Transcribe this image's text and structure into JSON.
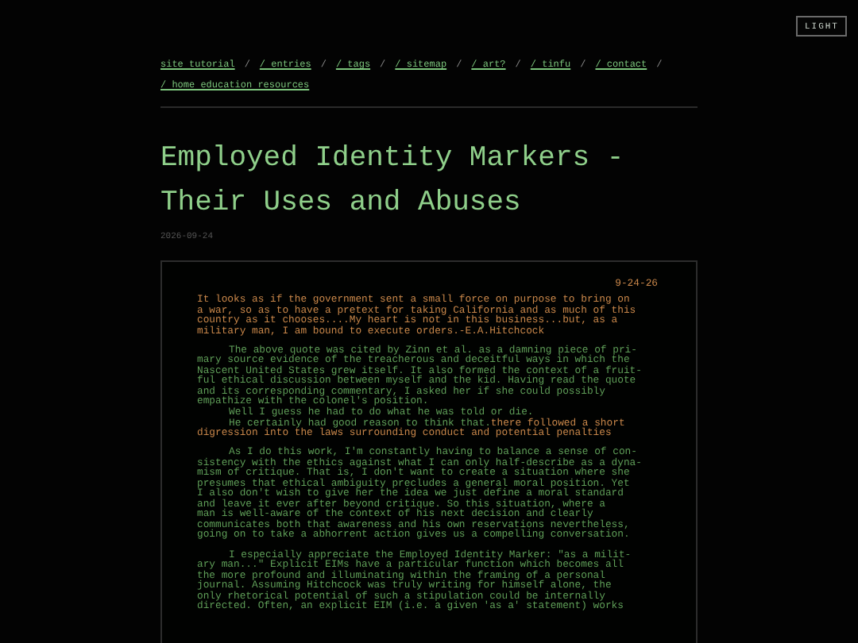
{
  "theme_button": "LIGHT",
  "nav": {
    "links": [
      "site tutorial",
      "/ entries",
      "/ tags",
      "/ sitemap",
      "/ art?",
      "/ tinfu",
      "/ contact",
      "/ home education resources"
    ],
    "separator": "/"
  },
  "title": "Employed Identity Markers - Their Uses and Abuses",
  "date": "2026-09-24",
  "document": {
    "date": "9-24-26",
    "paragraphs": [
      {
        "lines": [
          {
            "indent": false,
            "segments": [
              {
                "text": "It looks as if the government sent a small force on purpose to bring on",
                "color": "#c9874a"
              }
            ]
          },
          {
            "indent": false,
            "segments": [
              {
                "text": "a war, so as to have a pretext for taking California and as much of this",
                "color": "#c9874a"
              }
            ]
          },
          {
            "indent": false,
            "segments": [
              {
                "text": "country as it chooses....My heart is not in this business...but, as a",
                "color": "#c9874a"
              }
            ]
          },
          {
            "indent": false,
            "segments": [
              {
                "text": "military man, I am bound to execute orders.-E.A.Hitchcock",
                "color": "#c9874a"
              }
            ]
          }
        ]
      },
      {
        "lines": [
          {
            "indent": true,
            "segments": [
              {
                "text": "The above quote was cited by Zinn et al. as a damning piece of pri-",
                "color": "#5f9e58"
              }
            ]
          },
          {
            "indent": false,
            "segments": [
              {
                "text": "mary source evidence of the treacherous and deceitful ways in which the",
                "color": "#5f9e58"
              }
            ]
          },
          {
            "indent": false,
            "segments": [
              {
                "text": "Nascent United States grew itself. It also formed the context of a fruit-",
                "color": "#5f9e58"
              }
            ]
          },
          {
            "indent": false,
            "segments": [
              {
                "text": "ful ethical discussion between myself and the kid. Having read the quote",
                "color": "#5f9e58"
              }
            ]
          },
          {
            "indent": false,
            "segments": [
              {
                "text": "and its corresponding commentary, I asked her if she could possibly",
                "color": "#5f9e58"
              }
            ]
          },
          {
            "indent": false,
            "segments": [
              {
                "text": "empathize with the colonel's position.",
                "color": "#5f9e58"
              }
            ]
          },
          {
            "indent": true,
            "segments": [
              {
                "text": "Well I guess he had to do what he was told or die.",
                "color": "#5f9e58"
              }
            ]
          },
          {
            "indent": true,
            "segments": [
              {
                "text": "He certainly had good reason to think that.",
                "color": "#5f9e58"
              },
              {
                "text": "there followed a short",
                "color": "#c9874a"
              }
            ]
          },
          {
            "indent": false,
            "segments": [
              {
                "text": "digression into the laws surrounding conduct and potential penalties",
                "color": "#c9874a"
              }
            ]
          }
        ]
      },
      {
        "lines": [
          {
            "indent": true,
            "segments": [
              {
                "text": "As I do this work, I'm constantly having to balance a sense of con-",
                "color": "#5f9e58"
              }
            ]
          },
          {
            "indent": false,
            "segments": [
              {
                "text": "sistency with the ethics against what I can only half-describe as a dyna-",
                "color": "#5f9e58"
              }
            ]
          },
          {
            "indent": false,
            "segments": [
              {
                "text": "mism of critique. That is, I don't want to create a situation where she",
                "color": "#5f9e58"
              }
            ]
          },
          {
            "indent": false,
            "segments": [
              {
                "text": "presumes that ethical ambiguity precludes a general moral position. Yet",
                "color": "#5f9e58"
              }
            ]
          },
          {
            "indent": false,
            "segments": [
              {
                "text": "I also don't wish to give her the idea we just define a moral standard",
                "color": "#5f9e58"
              }
            ]
          },
          {
            "indent": false,
            "segments": [
              {
                "text": "and leave it ever after beyond critique. So this situation, where a",
                "color": "#5f9e58"
              }
            ]
          },
          {
            "indent": false,
            "segments": [
              {
                "text": "man is well-aware of the context of his next decision and clearly",
                "color": "#5f9e58"
              }
            ]
          },
          {
            "indent": false,
            "segments": [
              {
                "text": "communicates both that awareness and his own reservations nevertheless,",
                "color": "#5f9e58"
              }
            ]
          },
          {
            "indent": false,
            "segments": [
              {
                "text": "going on to take a abhorrent action gives us a compelling conversation.",
                "color": "#5f9e58"
              }
            ]
          }
        ]
      },
      {
        "lines": [
          {
            "indent": true,
            "segments": [
              {
                "text": "I especially appreciate the Employed Identity Marker: \"as a milit-",
                "color": "#5f9e58"
              }
            ]
          },
          {
            "indent": false,
            "segments": [
              {
                "text": "ary man...\" Explicit EIMs have a particular function which becomes all",
                "color": "#5f9e58"
              }
            ]
          },
          {
            "indent": false,
            "segments": [
              {
                "text": "the more profound and illuminating within the framing of a personal",
                "color": "#5f9e58"
              }
            ]
          },
          {
            "indent": false,
            "segments": [
              {
                "text": "journal. Assuming Hitchcock was truly writing for himself alone, the",
                "color": "#5f9e58"
              }
            ]
          },
          {
            "indent": false,
            "segments": [
              {
                "text": "only rhetorical potential of such a stipulation could be internally",
                "color": "#5f9e58"
              }
            ]
          },
          {
            "indent": false,
            "segments": [
              {
                "text": "directed. Often, an explicit EIM (i.e. a given 'as a' statement) works",
                "color": "#5f9e58"
              }
            ]
          }
        ]
      }
    ]
  }
}
